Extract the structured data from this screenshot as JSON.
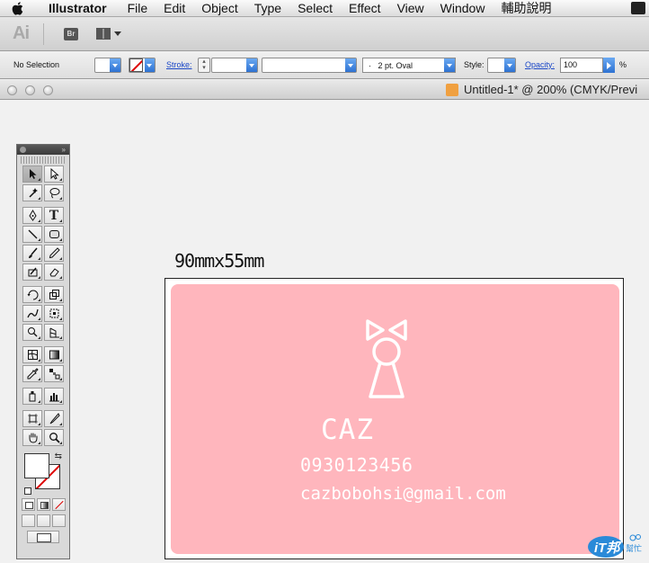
{
  "menubar": {
    "app": "Illustrator",
    "items": [
      "File",
      "Edit",
      "Object",
      "Type",
      "Select",
      "Effect",
      "View",
      "Window",
      "輔助說明"
    ]
  },
  "appbar": {
    "logo": "Ai",
    "bridge": "Br"
  },
  "controlbar": {
    "selection": "No Selection",
    "stroke_label": "Stroke:",
    "brush_value": "2 pt. Oval",
    "brush_prefix": "·",
    "style_label": "Style:",
    "opacity_label": "Opacity:",
    "opacity_value": "100",
    "percent": "%"
  },
  "document": {
    "title": "Untitled-1* @ 200% (CMYK/Previ"
  },
  "artwork": {
    "dimension_label": "90mmx55mm",
    "name": "CAZ",
    "phone": "0930123456",
    "email": "cazbobohsi@gmail.com",
    "card_color": "#ffb6bd"
  },
  "watermark": {
    "brand": "iT邦",
    "sub": "幫忙"
  },
  "colors": {
    "accent_blue": "#2e72d2",
    "link_blue": "#1a47c8"
  }
}
